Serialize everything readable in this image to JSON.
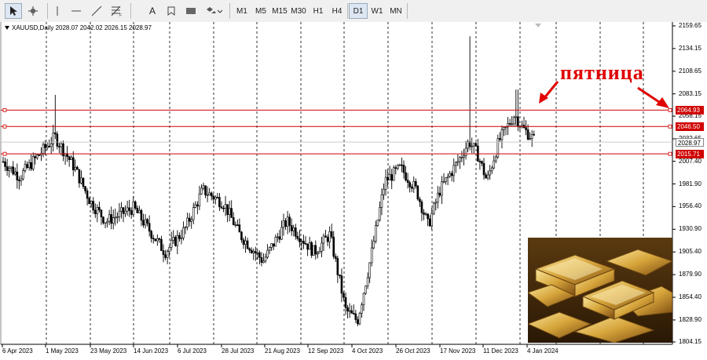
{
  "toolbar": {
    "tools": [
      {
        "name": "cursor-tool",
        "icon": "cursor-arrow-icon"
      },
      {
        "name": "crosshair-tool",
        "icon": "crosshair-icon"
      },
      {
        "name": "vertical-line-tool",
        "icon": "vertical-line-icon"
      },
      {
        "name": "horizontal-line-tool",
        "icon": "horizontal-line-icon"
      },
      {
        "name": "trendline-tool",
        "icon": "trendline-icon"
      },
      {
        "name": "fibonacci-tool",
        "icon": "fibonacci-icon"
      },
      {
        "name": "text-tool",
        "label": "A",
        "icon": "text-icon"
      },
      {
        "name": "text-label-tool",
        "icon": "text-label-icon"
      },
      {
        "name": "rectangle-tool",
        "icon": "rectangle-icon"
      },
      {
        "name": "shapes-tool",
        "icon": "shapes-dropdown-icon"
      }
    ],
    "timeframes": [
      "M1",
      "M5",
      "M15",
      "M30",
      "H1",
      "H4",
      "D1",
      "W1",
      "MN"
    ],
    "active_timeframe": "D1"
  },
  "chart": {
    "symbol_info": "XAUUSD,Daily  2028.07 2042.02 2026.15 2028.97",
    "annotation": "пятница",
    "image_icon": "gold-bars-image",
    "colors": {
      "level_line": "#d00000",
      "candle": "#000000",
      "annotation": "#e00000",
      "price_tag_bg": "#d00000"
    },
    "price_tags": [
      {
        "value": "2064.93",
        "style": "red"
      },
      {
        "value": "2046.50",
        "style": "red"
      },
      {
        "value": "2028.97",
        "style": "current"
      },
      {
        "value": "2015.71",
        "style": "red"
      }
    ]
  },
  "chart_data": {
    "type": "candlestick",
    "y_axis_labels": [
      "2159.65",
      "2134.15",
      "2108.65",
      "2083.15",
      "2058.15",
      "2032.65",
      "2007.40",
      "1981.90",
      "1956.40",
      "1930.90",
      "1905.40",
      "1879.90",
      "1854.40",
      "1828.90",
      "1804.15"
    ],
    "x_axis_labels": [
      "6 Apr 2023",
      "1 May 2023",
      "23 May 2023",
      "14 Jun 2023",
      "6 Jul 2023",
      "28 Jul 2023",
      "21 Aug 2023",
      "12 Sep 2023",
      "4 Oct 2023",
      "26 Oct 2023",
      "17 Nov 2023",
      "11 Dec 2023",
      "4 Jan 2024"
    ],
    "ylim": [
      1804.15,
      2159.65
    ],
    "horizontal_levels": [
      2064.93,
      2046.5,
      2015.71
    ],
    "current_price": 2028.97,
    "last_candle": {
      "open": 2028.07,
      "high": 2042.02,
      "low": 2026.15,
      "close": 2028.97
    },
    "close_path": [
      [
        "6 Apr 2023",
        2007
      ],
      [
        "1 May 2023",
        1990
      ],
      [
        "1 May 2023",
        2035
      ],
      [
        "23 May 2023",
        1975
      ],
      [
        "14 Jun 2023",
        1945
      ],
      [
        "6 Jul 2023",
        1915
      ],
      [
        "28 Jul 2023",
        1960
      ],
      [
        "21 Aug 2023",
        1890
      ],
      [
        "12 Sep 2023",
        1920
      ],
      [
        "4 Oct 2023",
        1825
      ],
      [
        "26 Oct 2023",
        1990
      ],
      [
        "17 Nov 2023",
        1975
      ],
      [
        "11 Dec 2023",
        2040
      ],
      [
        "4 Jan 2024",
        2030
      ]
    ]
  }
}
